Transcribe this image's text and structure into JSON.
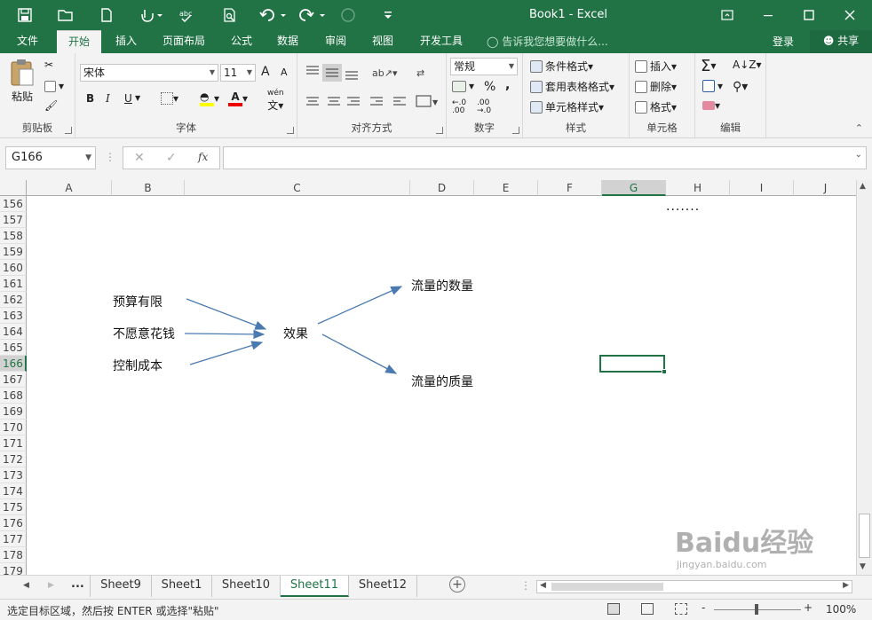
{
  "title": "Book1 - Excel",
  "menu": {
    "tabs": [
      "文件",
      "开始",
      "插入",
      "页面布局",
      "公式",
      "数据",
      "审阅",
      "视图",
      "开发工具"
    ],
    "active_tab": "开始",
    "tell_me": "告诉我您想要做什么...",
    "login": "登录",
    "share": "共享"
  },
  "ribbon": {
    "clipboard": {
      "label": "剪贴板",
      "paste": "粘贴"
    },
    "font": {
      "label": "字体",
      "name": "宋体",
      "size": "11",
      "grow": "A",
      "shrink": "A",
      "bold": "B",
      "italic": "I",
      "underline": "U",
      "wen": "wén"
    },
    "alignment": {
      "label": "对齐方式"
    },
    "number": {
      "label": "数字",
      "format": "常规",
      "percent": "%",
      "comma": ","
    },
    "styles": {
      "label": "样式",
      "conditional": "条件格式",
      "table": "套用表格格式",
      "cell_styles": "单元格样式"
    },
    "cells": {
      "label": "单元格",
      "insert": "插入",
      "delete": "删除",
      "format": "格式"
    },
    "editing": {
      "label": "编辑"
    }
  },
  "formula_bar": {
    "name_box": "G166",
    "fx": "fx",
    "formula": ""
  },
  "columns": [
    "A",
    "B",
    "C",
    "D",
    "E",
    "F",
    "G",
    "H",
    "I",
    "J"
  ],
  "active_column": "G",
  "rows": [
    "156",
    "157",
    "158",
    "159",
    "160",
    "161",
    "162",
    "163",
    "164",
    "165",
    "166",
    "167",
    "168",
    "169",
    "170",
    "171",
    "172",
    "173",
    "174",
    "175",
    "176",
    "177",
    "178",
    "179"
  ],
  "active_row": "166",
  "diagram": {
    "dots": ".......",
    "causes": [
      "预算有限",
      "不愿意花钱",
      "控制成本"
    ],
    "center": "效果",
    "outcomes": [
      "流量的数量",
      "流量的质量"
    ]
  },
  "sheets": {
    "ellipsis": "...",
    "names": [
      "Sheet9",
      "Sheet1",
      "Sheet10",
      "Sheet11",
      "Sheet12"
    ],
    "active": "Sheet11"
  },
  "status": {
    "message": "选定目标区域，然后按 ENTER 或选择\"粘贴\"",
    "zoom": "100%",
    "minus": "-",
    "plus": "+"
  },
  "watermark": {
    "brand": "Baidu经验",
    "url": "jingyan.baidu.com"
  },
  "colors": {
    "accent": "#217346",
    "arrow": "#4a7ab0"
  }
}
